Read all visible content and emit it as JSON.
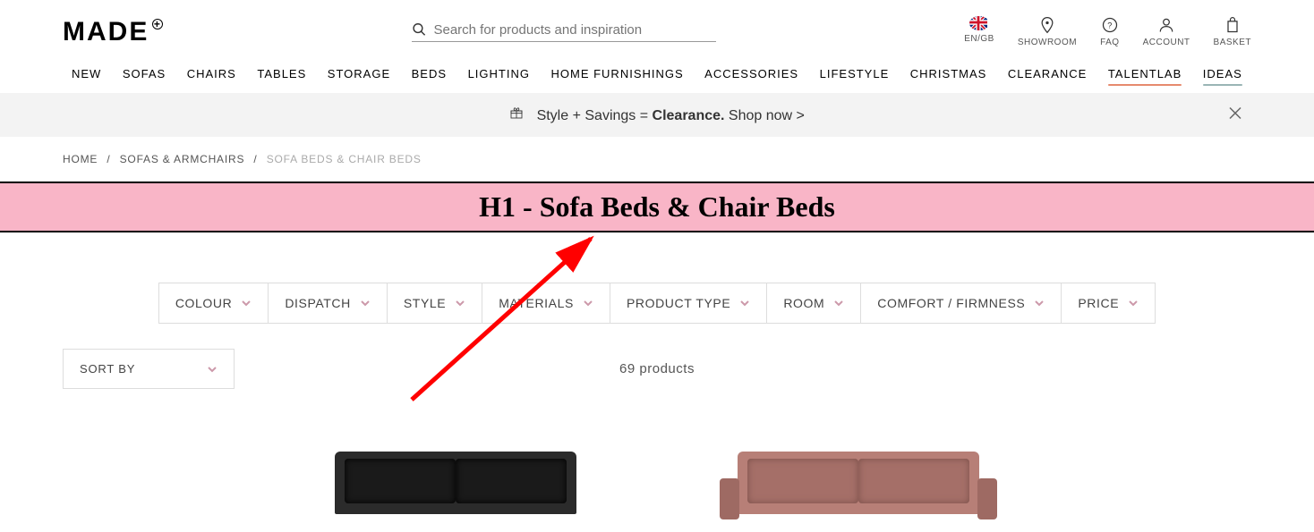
{
  "logo": "MADE",
  "search": {
    "placeholder": "Search for products and inspiration"
  },
  "utility_nav": {
    "locale": "EN/GB",
    "showroom": "SHOWROOM",
    "faq": "FAQ",
    "account": "ACCOUNT",
    "basket": "BASKET"
  },
  "main_nav": [
    "NEW",
    "SOFAS",
    "CHAIRS",
    "TABLES",
    "STORAGE",
    "BEDS",
    "LIGHTING",
    "HOME FURNISHINGS",
    "ACCESSORIES",
    "LIFESTYLE",
    "CHRISTMAS",
    "CLEARANCE",
    "TALENTLAB",
    "IDEAS"
  ],
  "promo": {
    "text_before": "Style + Savings = ",
    "bold": "Clearance.",
    "text_after": " Shop now >"
  },
  "breadcrumb": {
    "items": [
      "HOME",
      "SOFAS & ARMCHAIRS"
    ],
    "current": "SOFA BEDS & CHAIR BEDS"
  },
  "h1_annotation": "H1 - Sofa Beds & Chair Beds",
  "filters": [
    "COLOUR",
    "DISPATCH",
    "STYLE",
    "MATERIALS",
    "PRODUCT TYPE",
    "ROOM",
    "COMFORT / FIRMNESS",
    "PRICE"
  ],
  "sort_label": "SORT BY",
  "product_count": "69 products",
  "annotation_arrow_color": "#ff0000"
}
